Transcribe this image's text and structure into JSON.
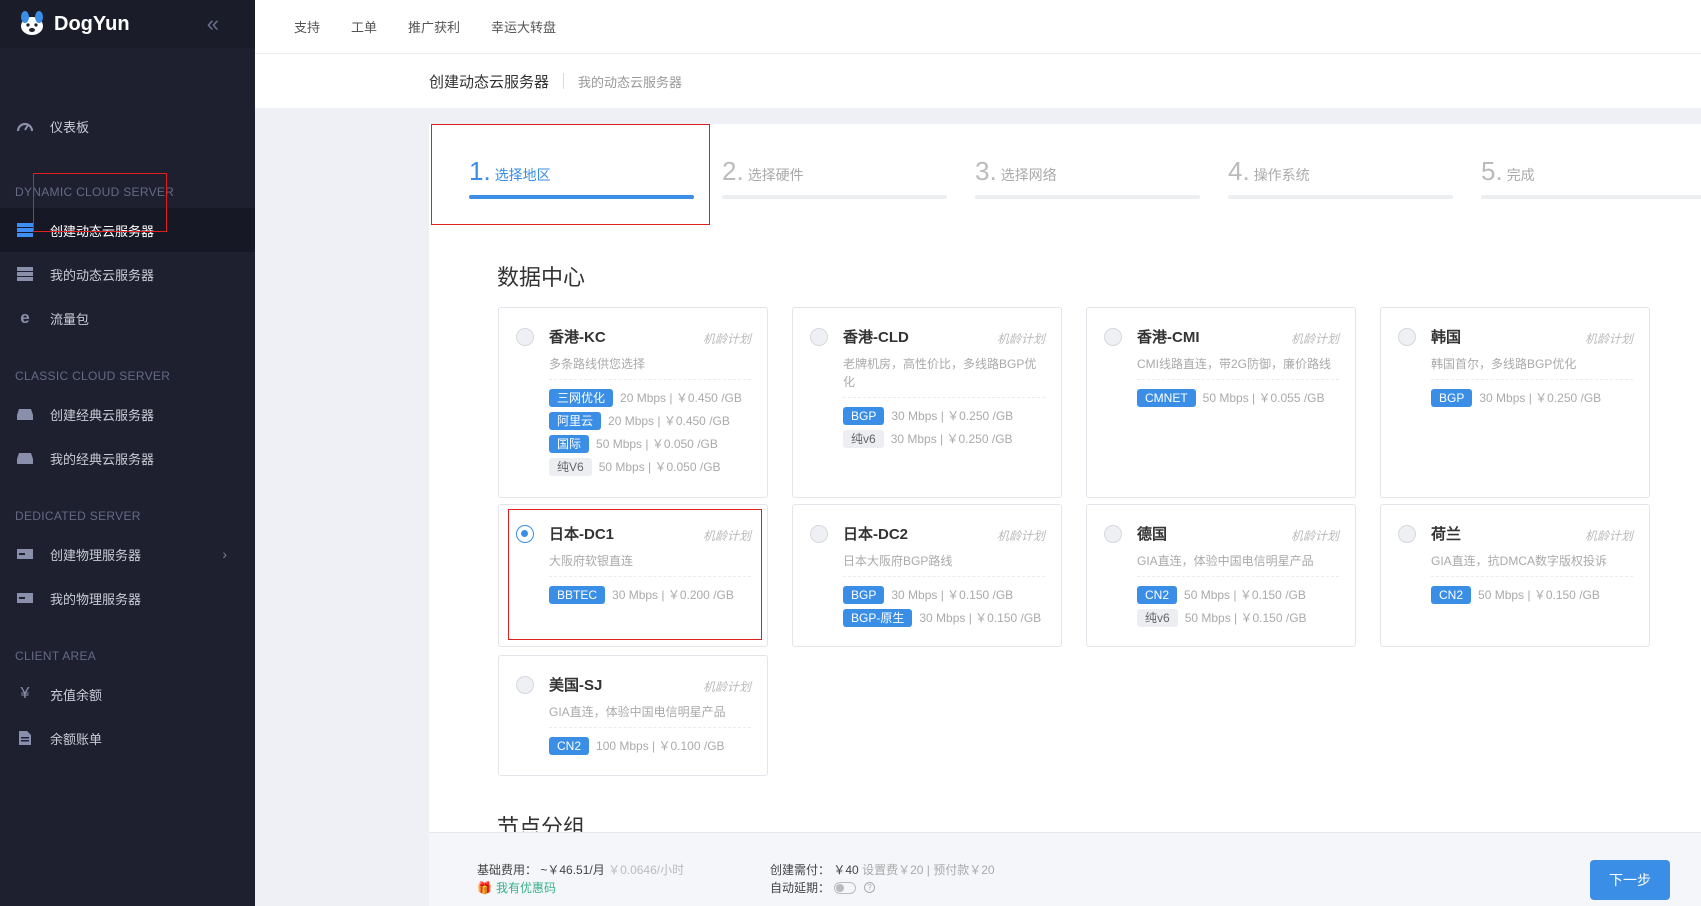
{
  "app": {
    "brand": "DogYun"
  },
  "sidebar": {
    "dashboard": "仪表板",
    "sections": {
      "dynamic": "DYNAMIC CLOUD SERVER",
      "classic": "CLASSIC CLOUD SERVER",
      "dedicated": "DEDICATED SERVER",
      "client": "CLIENT AREA"
    },
    "items": {
      "create_dynamic": "创建动态云服务器",
      "my_dynamic": "我的动态云服务器",
      "traffic": "流量包",
      "create_classic": "创建经典云服务器",
      "my_classic": "我的经典云服务器",
      "create_physical": "创建物理服务器",
      "my_physical": "我的物理服务器",
      "recharge": "充值余额",
      "bill": "余额账单"
    }
  },
  "topbar": {
    "links": [
      "支持",
      "工单",
      "推广获利",
      "幸运大转盘"
    ]
  },
  "breadcrumb": {
    "current": "创建动态云服务器",
    "link": "我的动态云服务器"
  },
  "steps": [
    {
      "num": "1.",
      "label": "选择地区",
      "active": true
    },
    {
      "num": "2.",
      "label": "选择硬件",
      "active": false
    },
    {
      "num": "3.",
      "label": "选择网络",
      "active": false
    },
    {
      "num": "4.",
      "label": "操作系统",
      "active": false
    },
    {
      "num": "5.",
      "label": "完成",
      "active": false
    }
  ],
  "datacenter": {
    "title": "数据中心",
    "age_label": "机龄计划",
    "cards": [
      {
        "name": "香港-KC",
        "desc": "多条路线供您选择",
        "selected": false,
        "lines": [
          {
            "tag": "三网优化",
            "gray": false,
            "spec": "20 Mbps | ￥0.450 /GB"
          },
          {
            "tag": "阿里云",
            "gray": false,
            "spec": "20 Mbps | ￥0.450 /GB"
          },
          {
            "tag": "国际",
            "gray": false,
            "spec": "50 Mbps | ￥0.050 /GB"
          },
          {
            "tag": "纯V6",
            "gray": true,
            "spec": "50 Mbps | ￥0.050 /GB"
          }
        ]
      },
      {
        "name": "香港-CLD",
        "desc": "老牌机房，高性价比，多线路BGP优化",
        "selected": false,
        "lines": [
          {
            "tag": "BGP",
            "gray": false,
            "spec": "30 Mbps | ￥0.250 /GB"
          },
          {
            "tag": "纯v6",
            "gray": true,
            "spec": "30 Mbps | ￥0.250 /GB"
          }
        ]
      },
      {
        "name": "香港-CMI",
        "desc": "CMI线路直连，带2G防御，廉价路线",
        "selected": false,
        "lines": [
          {
            "tag": "CMNET",
            "gray": false,
            "spec": "50 Mbps | ￥0.055 /GB"
          }
        ]
      },
      {
        "name": "韩国",
        "desc": "韩国首尔，多线路BGP优化",
        "selected": false,
        "lines": [
          {
            "tag": "BGP",
            "gray": false,
            "spec": "30 Mbps | ￥0.250 /GB"
          }
        ]
      },
      {
        "name": "日本-DC1",
        "desc": "大阪府软银直连",
        "selected": true,
        "lines": [
          {
            "tag": "BBTEC",
            "gray": false,
            "spec": "30 Mbps | ￥0.200 /GB"
          }
        ]
      },
      {
        "name": "日本-DC2",
        "desc": "日本大阪府BGP路线",
        "selected": false,
        "lines": [
          {
            "tag": "BGP",
            "gray": false,
            "spec": "30 Mbps | ￥0.150 /GB"
          },
          {
            "tag": "BGP-原生",
            "gray": false,
            "spec": "30 Mbps | ￥0.150 /GB"
          }
        ]
      },
      {
        "name": "德国",
        "desc": "GIA直连，体验中国电信明星产品",
        "selected": false,
        "lines": [
          {
            "tag": "CN2",
            "gray": false,
            "spec": "50 Mbps | ￥0.150 /GB"
          },
          {
            "tag": "纯v6",
            "gray": true,
            "spec": "50 Mbps | ￥0.150 /GB"
          }
        ]
      },
      {
        "name": "荷兰",
        "desc": "GIA直连，抗DMCA数字版权投诉",
        "selected": false,
        "lines": [
          {
            "tag": "CN2",
            "gray": false,
            "spec": "50 Mbps | ￥0.150 /GB"
          }
        ]
      },
      {
        "name": "美国-SJ",
        "desc": "GIA直连，体验中国电信明星产品",
        "selected": false,
        "lines": [
          {
            "tag": "CN2",
            "gray": false,
            "spec": "100 Mbps | ￥0.100 /GB"
          }
        ]
      }
    ]
  },
  "node_group": {
    "title": "节点分组"
  },
  "footer": {
    "base_fee_label": "基础费用：",
    "base_fee_value": "~￥46.51/月",
    "base_fee_hourly": "￥0.0646/小时",
    "coupon": "我有优惠码",
    "deposit_label": "创建需付：",
    "deposit_value": "￥40",
    "deposit_detail": "设置费￥20 | 预付款￥20",
    "auto_renew_label": "自动延期：",
    "next_button": "下一步"
  }
}
